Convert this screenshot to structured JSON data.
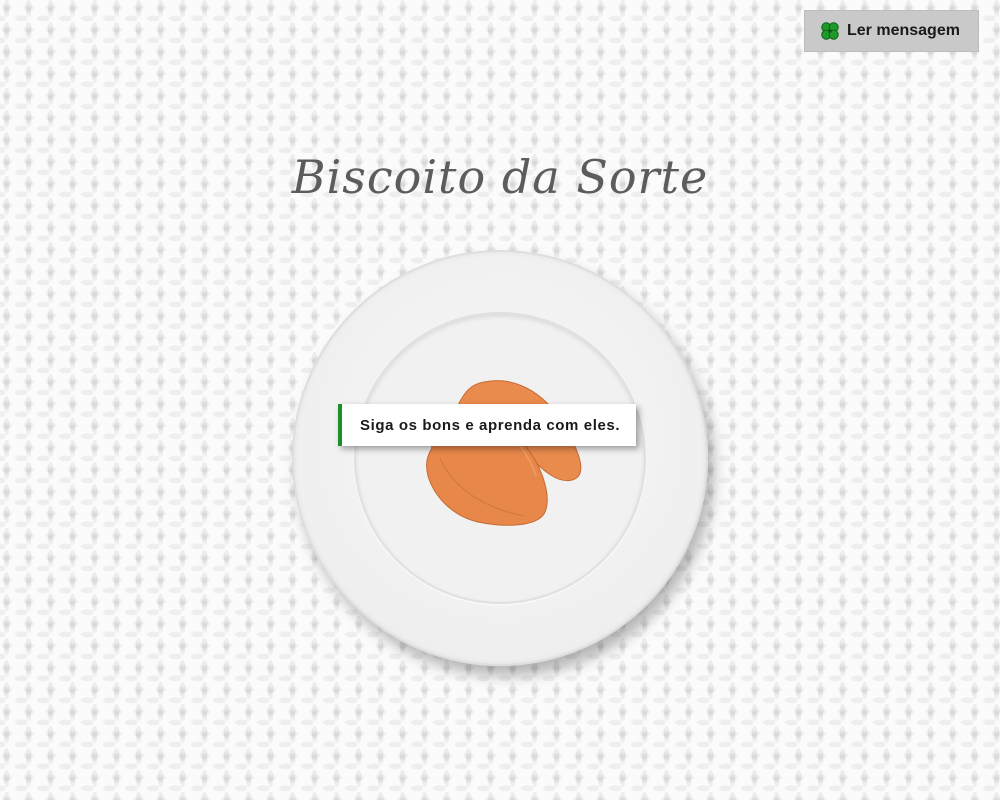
{
  "header": {
    "read_button_label": "Ler mensagem",
    "read_button_icon": "four-leaf-clover-icon"
  },
  "main": {
    "title": "Biscoito da Sorte",
    "fortune_message": "Siga os bons e aprenda com eles."
  },
  "colors": {
    "accent": "#1f8f2a",
    "cookie": "#e8874a",
    "button_bg": "#c9c9c9",
    "title": "#5c5c5c"
  }
}
